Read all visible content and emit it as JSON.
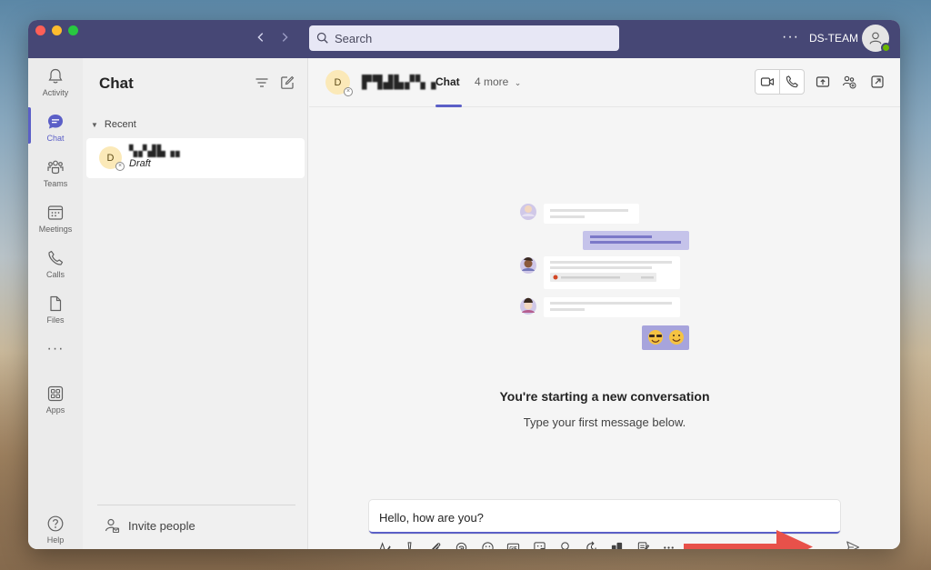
{
  "window": {
    "search_placeholder": "Search",
    "more_label": "···",
    "org_name": "DS-TEAM"
  },
  "rail": {
    "items": [
      {
        "label": "Activity",
        "icon": "bell-icon"
      },
      {
        "label": "Chat",
        "icon": "chat-icon",
        "active": true
      },
      {
        "label": "Teams",
        "icon": "teams-icon"
      },
      {
        "label": "Meetings",
        "icon": "calendar-icon"
      },
      {
        "label": "Calls",
        "icon": "phone-icon"
      },
      {
        "label": "Files",
        "icon": "file-icon"
      }
    ],
    "ellipsis": "···",
    "apps_label": "Apps",
    "help_label": "Help"
  },
  "chat_list": {
    "title": "Chat",
    "recent_label": "Recent",
    "items": [
      {
        "avatar_initial": "D",
        "name": "▚▞▟▙▗▖",
        "preview": "Draft"
      }
    ],
    "invite_label": "Invite people"
  },
  "main": {
    "header": {
      "avatar_initial": "D",
      "name": "▛▜▟▙▞▚▗",
      "tab_chat": "Chat",
      "more_tabs": "4 more"
    },
    "empty_title": "You're starting a new conversation",
    "empty_subtitle": "Type your first message below.",
    "composer_text": "Hello, how are you?",
    "accent_color": "#5b5fc7",
    "titlebar_color": "#464775",
    "annotation_arrow_color": "#e8514a"
  }
}
